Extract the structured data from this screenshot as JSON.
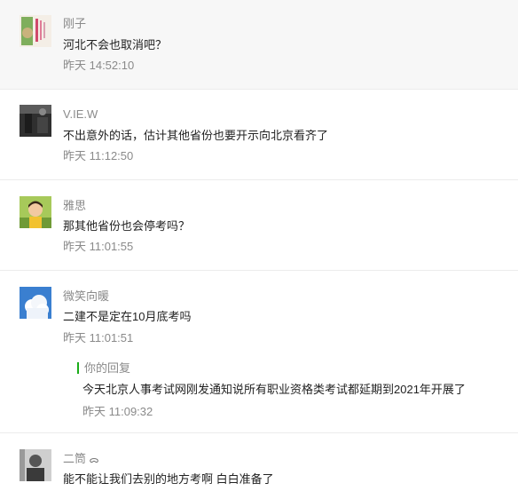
{
  "comments": [
    {
      "nickname": "刚子",
      "text": "河北不会也取消吧？",
      "time": "昨天 14:52:10",
      "avatar_icon": "book-cover-avatar-icon",
      "highlighted": true
    },
    {
      "nickname": "V.IE.W",
      "text": "不出意外的话，估计其他省份也要开示向北京看齐了",
      "time": "昨天 11:12:50",
      "avatar_icon": "dark-photo-avatar-icon"
    },
    {
      "nickname": "雅思",
      "text": "那其他省份也会停考吗？",
      "time": "昨天 11:01:55",
      "avatar_icon": "child-on-grass-avatar-icon"
    },
    {
      "nickname": "微笑向暖",
      "text": "二建不是定在10月底考吗",
      "time": "昨天 11:01:51",
      "avatar_icon": "cloud-sky-avatar-icon",
      "reply": {
        "label": "你的回复",
        "text": "今天北京人事考试网刚发通知说所有职业资格类考试都延期到2021年开展了",
        "time": "昨天 11:09:32"
      }
    },
    {
      "nickname": "二筒",
      "nickname_emoji": "ᯅ",
      "text": "能不能让我们去别的地方考啊 白白准备了",
      "avatar_icon": "bw-portrait-avatar-icon"
    }
  ],
  "colors": {
    "highlight_bg": "#f7f7f7",
    "reply_bar": "#1aad19",
    "meta_text": "#8a8a8a",
    "body_text": "#222222"
  }
}
